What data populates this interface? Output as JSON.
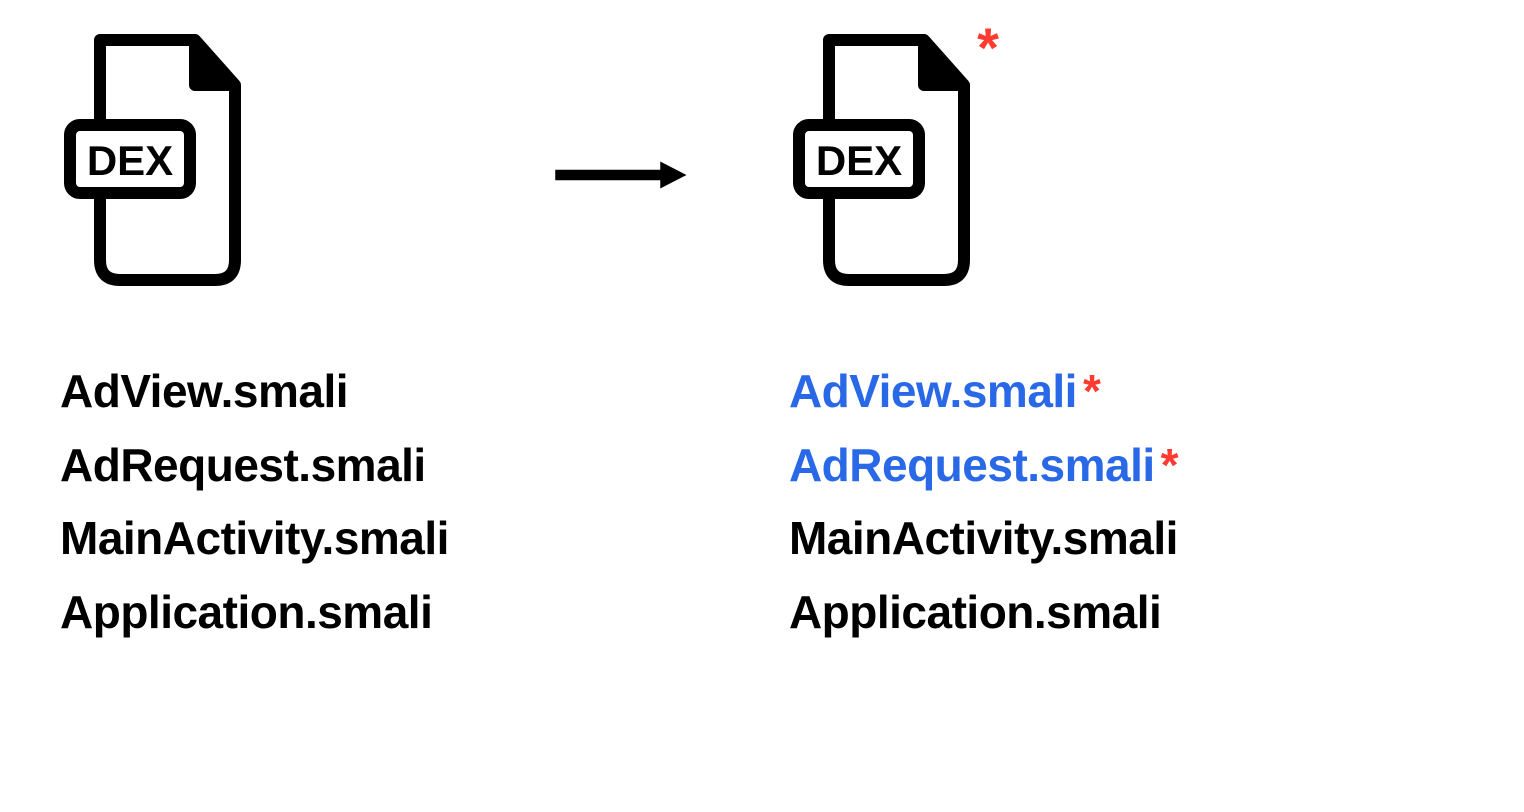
{
  "left": {
    "badge": "DEX",
    "files": [
      {
        "name": "AdView.smali",
        "modified": false
      },
      {
        "name": "AdRequest.smali",
        "modified": false
      },
      {
        "name": "MainActivity.smali",
        "modified": false
      },
      {
        "name": "Application.smali",
        "modified": false
      }
    ]
  },
  "right": {
    "badge": "DEX",
    "modified_marker": "*",
    "files": [
      {
        "name": "AdView.smali",
        "modified": true
      },
      {
        "name": "AdRequest.smali",
        "modified": true
      },
      {
        "name": "MainActivity.smali",
        "modified": false
      },
      {
        "name": "Application.smali",
        "modified": false
      }
    ]
  },
  "colors": {
    "modified": "#2968e6",
    "marker": "#ff3b2f",
    "default": "#000000"
  }
}
